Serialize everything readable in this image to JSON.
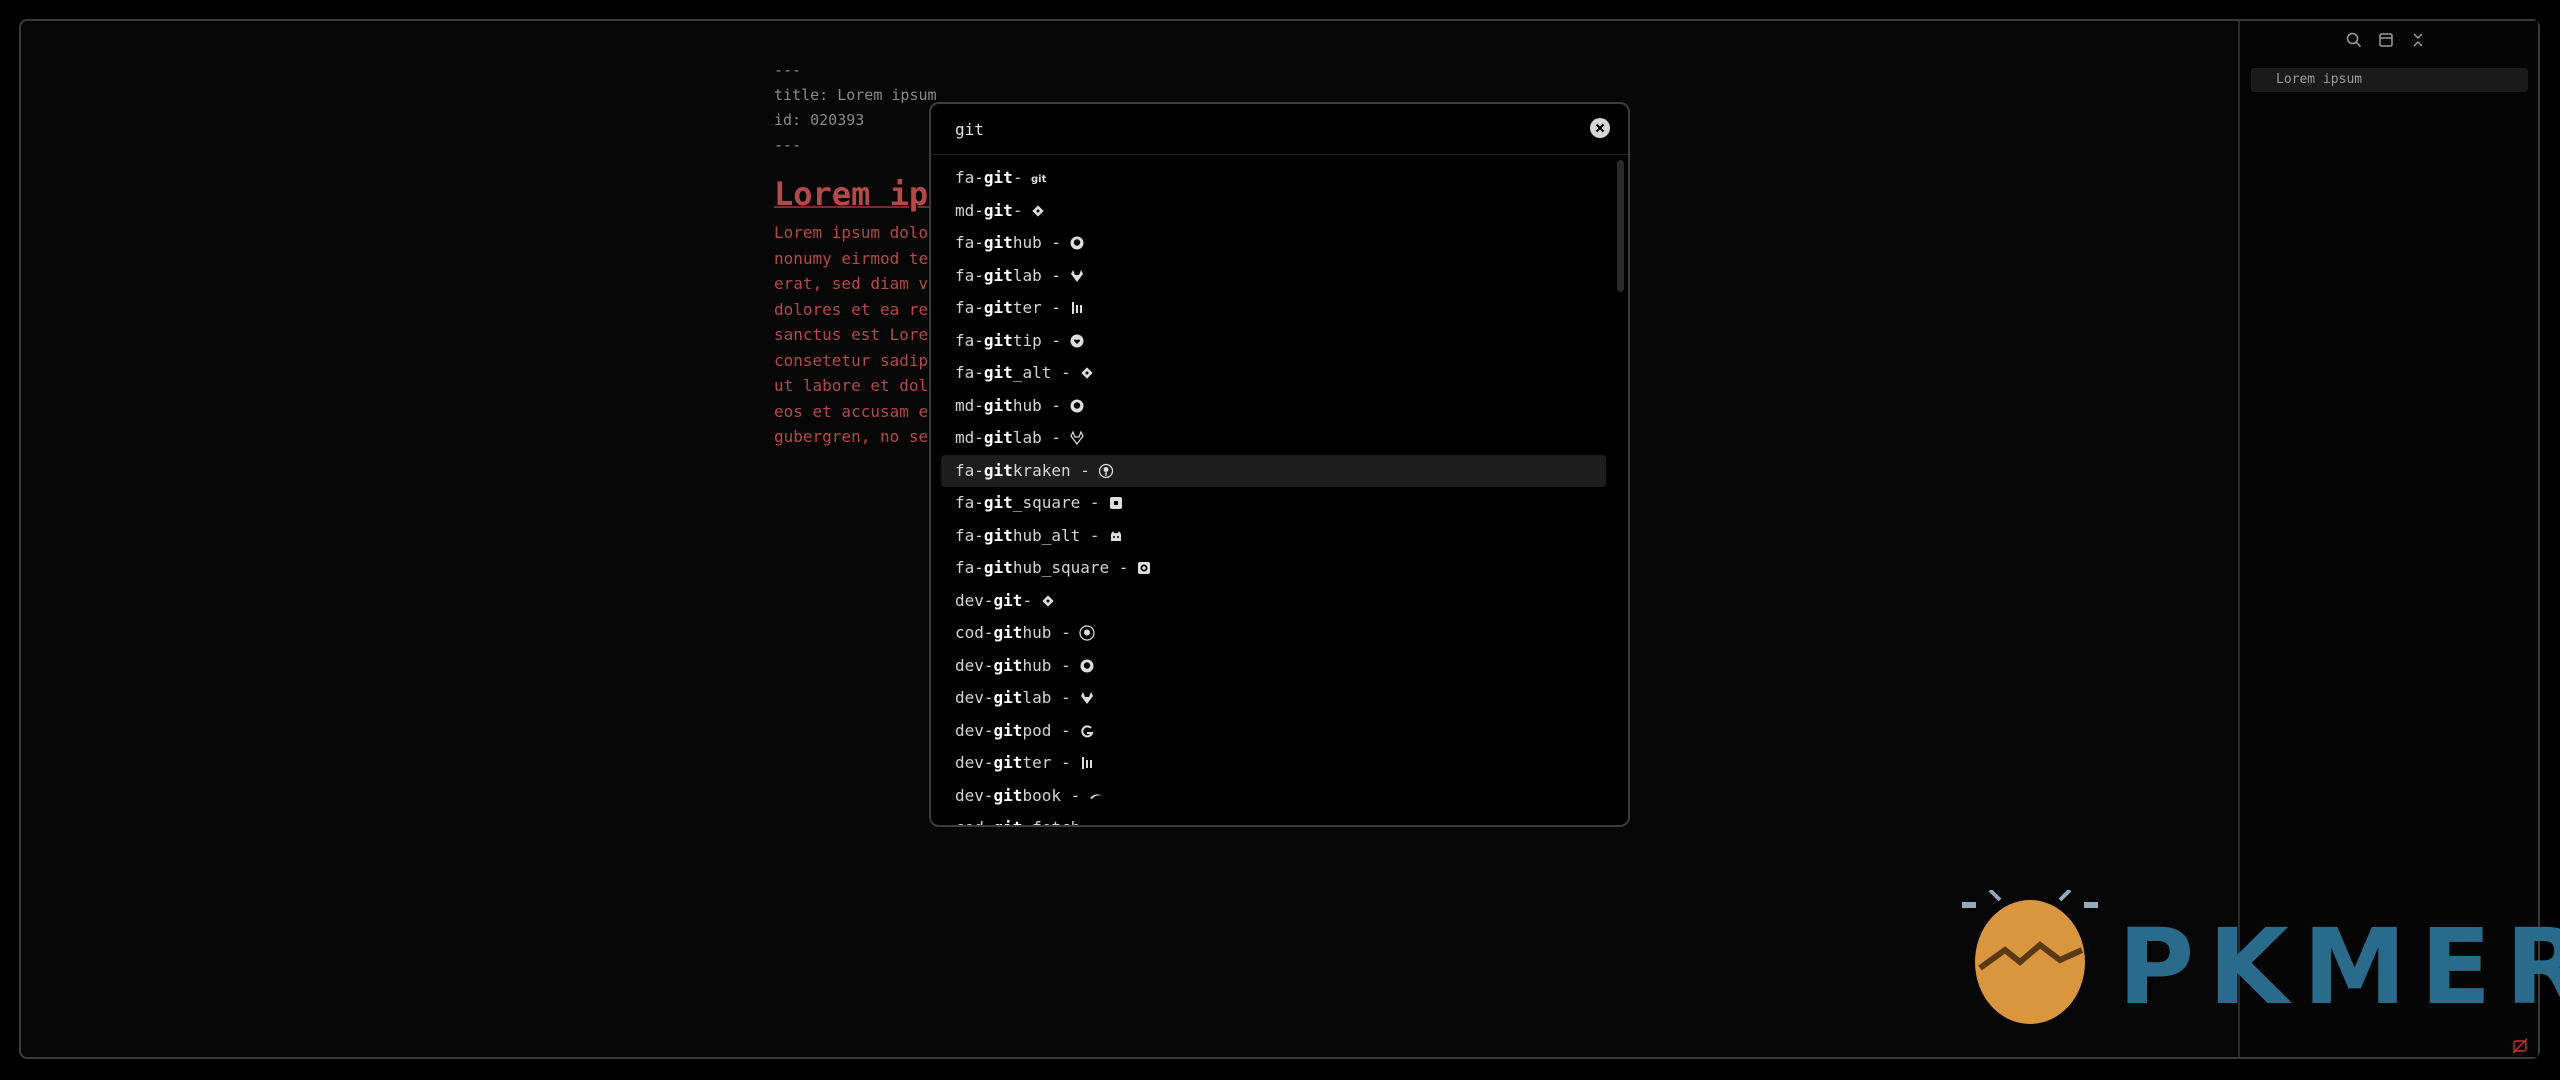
{
  "editor": {
    "frontmatter": [
      "---",
      "title: Lorem ipsum",
      "id: 020393",
      "---"
    ],
    "heading": "Lorem ipsum",
    "body_lines": [
      "Lorem ipsum dolo",
      "nonumy eirmod te",
      "erat, sed diam v",
      "dolores et ea re",
      "sanctus est Lore",
      "consetetur sadip",
      "ut labore et dol",
      "eos et accusam e",
      "gubergren, no se"
    ]
  },
  "sidebar": {
    "icons": [
      "search-icon",
      "bookmark-icon",
      "collapse-icon"
    ],
    "outline_item": "Lorem ipsum"
  },
  "modal": {
    "query": "git",
    "results": [
      {
        "prefix": "fa-",
        "match": "git",
        "suffix": "",
        "icon": "git-text-icon"
      },
      {
        "prefix": "md-",
        "match": "git",
        "suffix": "",
        "icon": "git-diamond-icon"
      },
      {
        "prefix": "fa-",
        "match": "git",
        "suffix": "hub",
        "icon": "github-icon"
      },
      {
        "prefix": "fa-",
        "match": "git",
        "suffix": "lab",
        "icon": "gitlab-icon"
      },
      {
        "prefix": "fa-",
        "match": "git",
        "suffix": "ter",
        "icon": "gitter-icon"
      },
      {
        "prefix": "fa-",
        "match": "git",
        "suffix": "tip",
        "icon": "gittip-icon"
      },
      {
        "prefix": "fa-",
        "match": "git",
        "suffix": "_alt",
        "icon": "git-diamond-icon"
      },
      {
        "prefix": "md-",
        "match": "git",
        "suffix": "hub",
        "icon": "github-icon"
      },
      {
        "prefix": "md-",
        "match": "git",
        "suffix": "lab",
        "icon": "gitlab-outline-icon"
      },
      {
        "prefix": "fa-",
        "match": "git",
        "suffix": "kraken",
        "icon": "gitkraken-icon"
      },
      {
        "prefix": "fa-",
        "match": "git",
        "suffix": "_square",
        "icon": "git-square-icon"
      },
      {
        "prefix": "fa-",
        "match": "git",
        "suffix": "hub_alt",
        "icon": "github-alt-icon"
      },
      {
        "prefix": "fa-",
        "match": "git",
        "suffix": "hub_square",
        "icon": "github-square-icon"
      },
      {
        "prefix": "dev-",
        "match": "git",
        "suffix": "",
        "icon": "git-diamond-icon"
      },
      {
        "prefix": "cod-",
        "match": "git",
        "suffix": "hub",
        "icon": "github-circle-icon"
      },
      {
        "prefix": "dev-",
        "match": "git",
        "suffix": "hub",
        "icon": "github-icon"
      },
      {
        "prefix": "dev-",
        "match": "git",
        "suffix": "lab",
        "icon": "gitlab-icon"
      },
      {
        "prefix": "dev-",
        "match": "git",
        "suffix": "pod",
        "icon": "gitpod-icon"
      },
      {
        "prefix": "dev-",
        "match": "git",
        "suffix": "ter",
        "icon": "gitter-icon"
      },
      {
        "prefix": "dev-",
        "match": "git",
        "suffix": "book",
        "icon": "gitbook-icon"
      },
      {
        "prefix": "cod-",
        "match": "git",
        "suffix": "_fetch",
        "icon": "git-fetch-icon"
      }
    ],
    "selected_index": 9
  },
  "watermark": {
    "text": "PKMER"
  },
  "colors": {
    "heading": "#b44a48",
    "selected_row": "#1d1d1d",
    "logo_orange": "#d9963f",
    "logo_text": "#2a6a8a"
  }
}
